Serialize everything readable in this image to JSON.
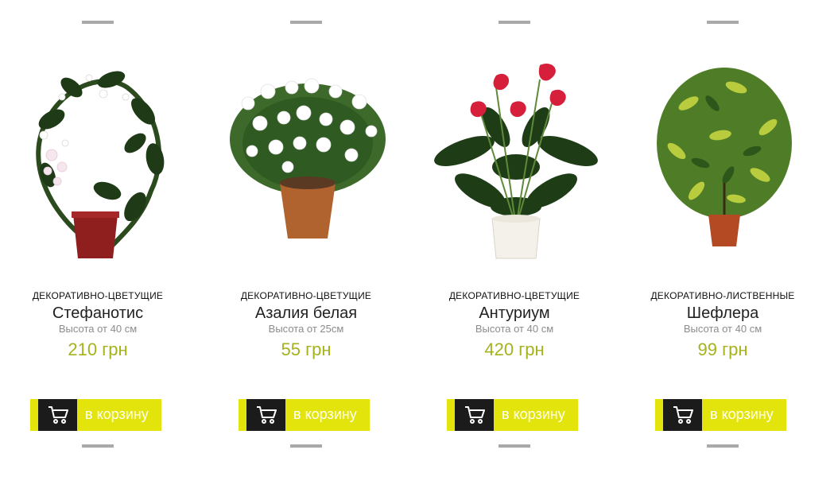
{
  "products": [
    {
      "category": "ДЕКОРАТИВНО-ЦВЕТУЩИЕ",
      "name": "Стефанотис",
      "height": "Высота от 40 см",
      "price": "210 грн",
      "cart_label": "в корзину"
    },
    {
      "category": "ДЕКОРАТИВНО-ЦВЕТУЩИЕ",
      "name": "Азалия белая",
      "height": "Высота от 25см",
      "price": "55 грн",
      "cart_label": "в корзину"
    },
    {
      "category": "ДЕКОРАТИВНО-ЦВЕТУЩИЕ",
      "name": "Антуриум",
      "height": "Высота от 40 см",
      "price": "420 грн",
      "cart_label": "в корзину"
    },
    {
      "category": "ДЕКОРАТИВНО-ЛИСТВЕННЫЕ",
      "name": "Шефлера",
      "height": "Высота от 40 см",
      "price": "99 грн",
      "cart_label": "в корзину"
    }
  ],
  "colors": {
    "accent": "#e2e40c",
    "price": "#a5b21c",
    "icon_box": "#1b1b1b",
    "divider": "#a9a9a9"
  },
  "icons": {
    "cart": "shopping-cart-icon"
  }
}
